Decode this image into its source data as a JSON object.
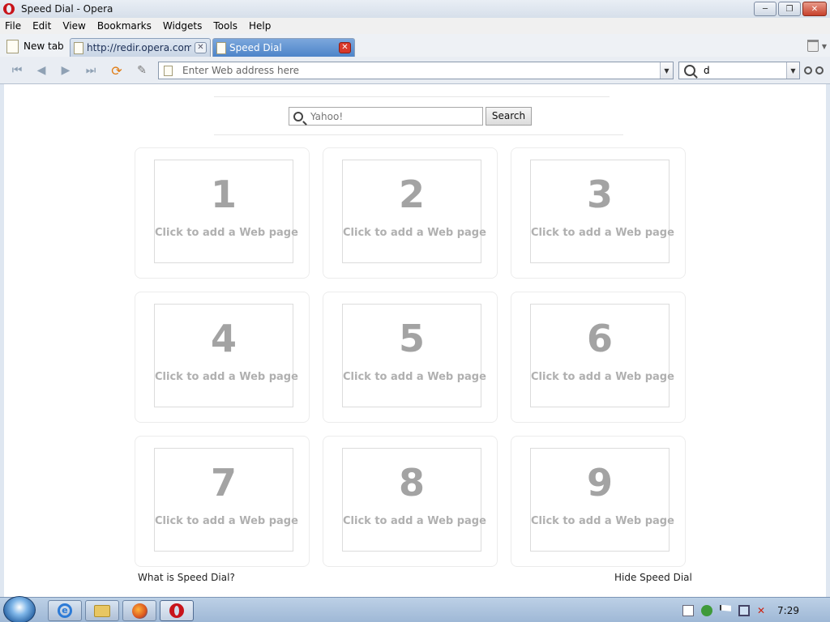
{
  "window": {
    "title": "Speed Dial - Opera"
  },
  "menu": [
    "File",
    "Edit",
    "View",
    "Bookmarks",
    "Widgets",
    "Tools",
    "Help"
  ],
  "tabs": {
    "new_tab": "New tab",
    "items": [
      {
        "label": "http://redir.opera.com...",
        "active": false
      },
      {
        "label": "Speed Dial",
        "active": true
      }
    ]
  },
  "nav": {
    "address_placeholder": "Enter Web address here",
    "search_text": "d"
  },
  "page": {
    "search_placeholder": "Yahoo!",
    "search_button": "Search",
    "dials": [
      {
        "num": "1",
        "text": "Click to add a Web page"
      },
      {
        "num": "2",
        "text": "Click to add a Web page"
      },
      {
        "num": "3",
        "text": "Click to add a Web page"
      },
      {
        "num": "4",
        "text": "Click to add a Web page"
      },
      {
        "num": "5",
        "text": "Click to add a Web page"
      },
      {
        "num": "6",
        "text": "Click to add a Web page"
      },
      {
        "num": "7",
        "text": "Click to add a Web page"
      },
      {
        "num": "8",
        "text": "Click to add a Web page"
      },
      {
        "num": "9",
        "text": "Click to add a Web page"
      }
    ],
    "what_is": "What is Speed Dial?",
    "hide": "Hide Speed Dial"
  },
  "taskbar": {
    "clock": "7:29"
  },
  "icons": {
    "nav": [
      "rewind-icon",
      "back-icon",
      "forward-icon",
      "fast-forward-icon",
      "reload-icon",
      "edit-icon"
    ],
    "tray": [
      "document-icon",
      "security-icon",
      "flag-icon",
      "network-icon",
      "volume-muted-icon"
    ]
  }
}
